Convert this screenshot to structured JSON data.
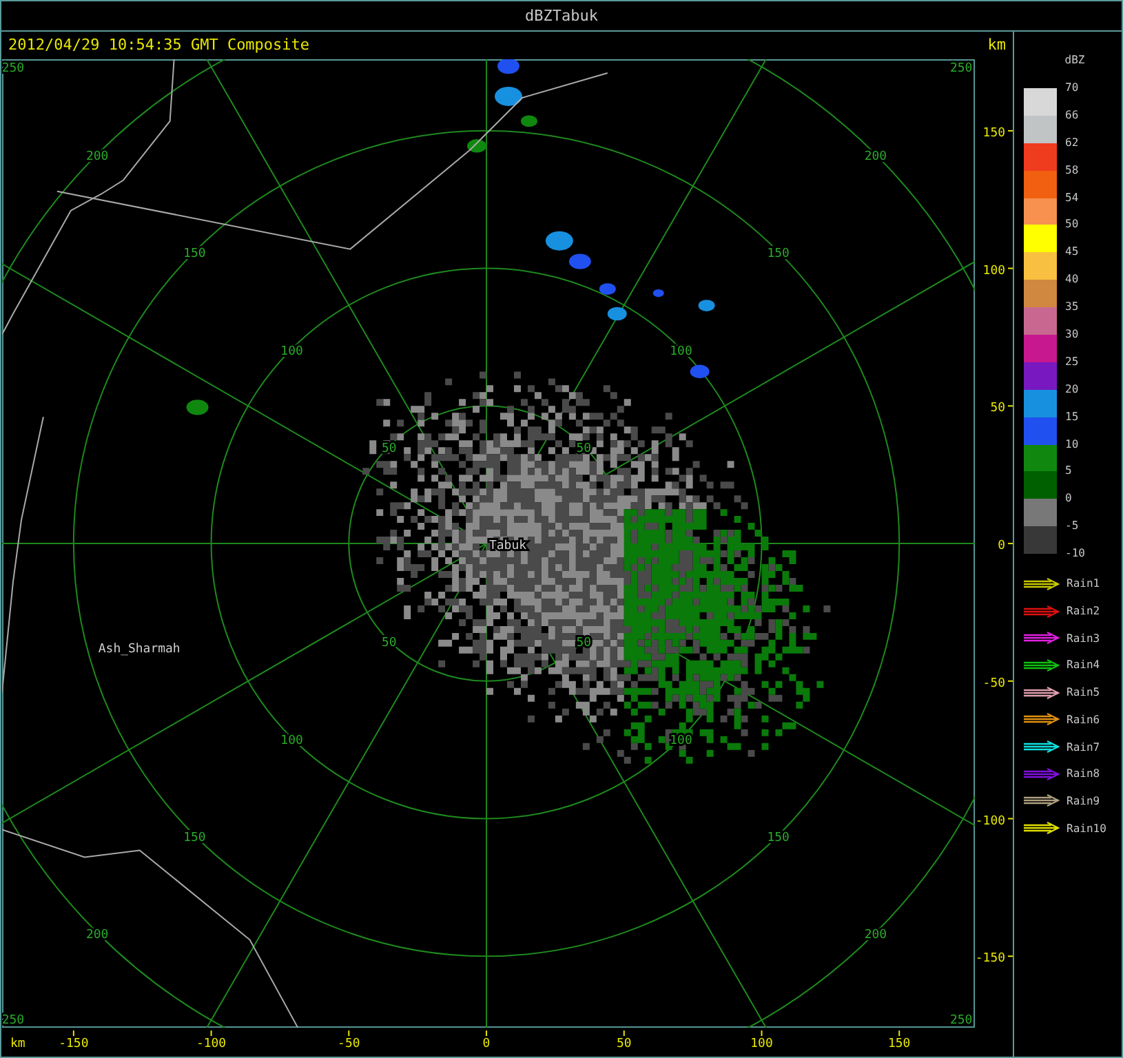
{
  "window": {
    "title": "dBZTabuk"
  },
  "header": {
    "timestamp": "2012/04/29 10:54:35 GMT Composite",
    "unit": "km"
  },
  "radar": {
    "range_rings": [
      {
        "labels": [
          "50",
          "50",
          "50",
          "50"
        ]
      },
      {
        "labels": [
          "100",
          "100",
          "100",
          "100"
        ]
      },
      {
        "labels": [
          "150",
          "150",
          "150",
          "150"
        ]
      },
      {
        "labels": [
          "200",
          "200",
          "200",
          "200"
        ]
      }
    ],
    "corner_labels": [
      "250",
      "250",
      "250",
      "250"
    ],
    "places": [
      "Tabuk",
      "Ash_Sharmah"
    ]
  },
  "y_axis": {
    "ticks": [
      "150",
      "100",
      "50",
      "0",
      "-50",
      "-100",
      "-150"
    ]
  },
  "x_axis": {
    "unit": "km",
    "ticks": [
      "-150",
      "-100",
      "-50",
      "0",
      "50",
      "100",
      "150"
    ]
  },
  "legend": {
    "title": "dBZ",
    "bands": [
      {
        "color": "#d8d8d8"
      },
      {
        "color": "#c0c4c4"
      },
      {
        "color": "#f03c1e"
      },
      {
        "color": "#f06010"
      },
      {
        "color": "#f89050"
      },
      {
        "color": "#ffff00"
      },
      {
        "color": "#f8c040"
      },
      {
        "color": "#d08840"
      },
      {
        "color": "#c86890"
      },
      {
        "color": "#c81890"
      },
      {
        "color": "#7818c0"
      },
      {
        "color": "#1890e0"
      },
      {
        "color": "#2050f0"
      },
      {
        "color": "#108810"
      },
      {
        "color": "#006000"
      },
      {
        "color": "#787878"
      },
      {
        "color": "#383838"
      }
    ],
    "labels": [
      "70",
      "66",
      "62",
      "58",
      "54",
      "50",
      "45",
      "40",
      "35",
      "30",
      "25",
      "20",
      "15",
      "10",
      "5",
      "0",
      "-5",
      "-10"
    ],
    "tracks": [
      {
        "label": "Rain1",
        "color": "#c8c800"
      },
      {
        "label": "Rain2",
        "color": "#e01010"
      },
      {
        "label": "Rain3",
        "color": "#e020e0"
      },
      {
        "label": "Rain4",
        "color": "#10c010"
      },
      {
        "label": "Rain5",
        "color": "#e0a0b0"
      },
      {
        "label": "Rain6",
        "color": "#e09010"
      },
      {
        "label": "Rain7",
        "color": "#10e0e0"
      },
      {
        "label": "Rain8",
        "color": "#8010e0"
      },
      {
        "label": "Rain9",
        "color": "#b0a080"
      },
      {
        "label": "Rain10",
        "color": "#e0e000"
      }
    ]
  }
}
